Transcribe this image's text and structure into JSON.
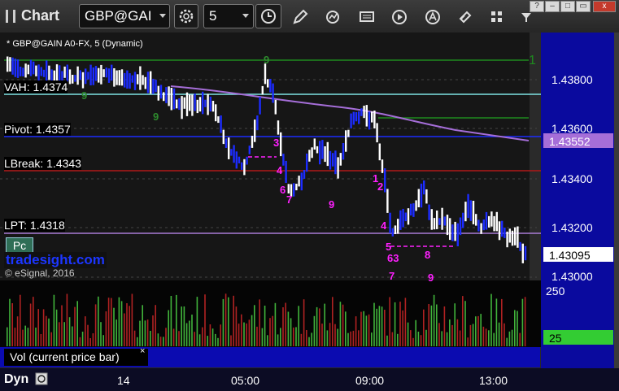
{
  "window": {
    "title": "Chart",
    "symbol": "GBP@GAI",
    "interval": "5"
  },
  "chart": {
    "header": "* GBP@GAIN A0-FX, 5 (Dynamic)",
    "levels": {
      "vah": "VAH: 1.4374",
      "pivot": "Pivot: 1.4357",
      "lbreak": "LBreak: 1.4343",
      "lpt": "LPT: 1.4318"
    },
    "pc_button": "Pc",
    "brand": "tradesight.com",
    "copyright": "© eSignal, 2016",
    "price_axis": [
      "1.43800",
      "1.43600",
      "1.43400",
      "1.43200",
      "1.43000"
    ],
    "tags": {
      "ma": "1.43552",
      "last": "1.43095"
    },
    "marker_top_right": "1",
    "volume": {
      "axis_top": "250",
      "tag": "25",
      "label": "Vol (current price bar)",
      "close": "×"
    },
    "time_axis": [
      "14",
      "05:00",
      "09:00",
      "13:00"
    ],
    "footer": {
      "dyn": "Dyn"
    },
    "markers": [
      {
        "t": "9",
        "c": "#2e8b2e"
      },
      {
        "t": "9",
        "c": "#2e8b2e"
      },
      {
        "t": "9",
        "c": "#2e8b2e"
      },
      {
        "t": "3",
        "c": "#ff20ff"
      },
      {
        "t": "4",
        "c": "#ff20ff"
      },
      {
        "t": "6",
        "c": "#ff20ff"
      },
      {
        "t": "7",
        "c": "#ff20ff"
      },
      {
        "t": "9",
        "c": "#ff20ff"
      },
      {
        "t": "1",
        "c": "#ff20ff"
      },
      {
        "t": "2",
        "c": "#ff20ff"
      },
      {
        "t": "4",
        "c": "#ff20ff"
      },
      {
        "t": "5",
        "c": "#ff20ff"
      },
      {
        "t": "63",
        "c": "#ff20ff"
      },
      {
        "t": "7",
        "c": "#ff20ff"
      },
      {
        "t": "8",
        "c": "#ff20ff"
      },
      {
        "t": "9",
        "c": "#ff20ff"
      }
    ],
    "colors": {
      "ma": "#a56ed8",
      "vah": "#7fe3e3",
      "pivot": "#1c2cff",
      "lbreak": "#b01818",
      "lpt": "#a97cd6",
      "green_line": "#1f8a1f",
      "up_bar": "#ffffff",
      "down_bar": "#1c2cff",
      "vol_up": "#41b33b",
      "vol_down": "#b02222",
      "volume_tag": "#33cc33"
    }
  }
}
